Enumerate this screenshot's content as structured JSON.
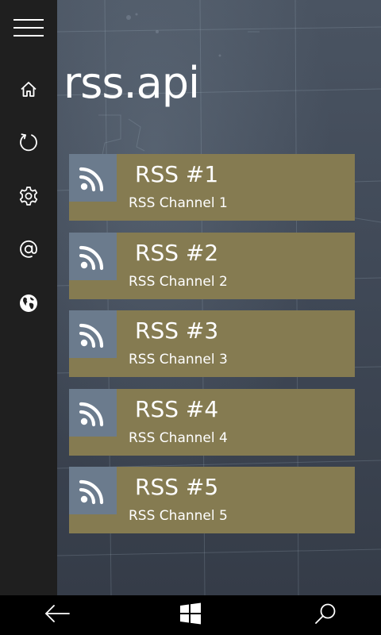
{
  "app": {
    "title": "rss.api"
  },
  "sidebar": {
    "menu_icon": "hamburger-menu-icon",
    "items": [
      {
        "name": "home",
        "icon": "home-icon"
      },
      {
        "name": "refresh",
        "icon": "refresh-icon"
      },
      {
        "name": "settings",
        "icon": "gear-icon"
      },
      {
        "name": "contact",
        "icon": "at-sign-icon"
      },
      {
        "name": "web",
        "icon": "globe-icon"
      }
    ]
  },
  "feeds": [
    {
      "title": "RSS #1",
      "subtitle": "RSS Channel 1",
      "icon": "rss-icon"
    },
    {
      "title": "RSS #2",
      "subtitle": "RSS Channel 2",
      "icon": "rss-icon"
    },
    {
      "title": "RSS #3",
      "subtitle": "RSS Channel 3",
      "icon": "rss-icon"
    },
    {
      "title": "RSS #4",
      "subtitle": "RSS Channel 4",
      "icon": "rss-icon"
    },
    {
      "title": "RSS #5",
      "subtitle": "RSS Channel 5",
      "icon": "rss-icon"
    }
  ],
  "system_bar": {
    "back_icon": "back-arrow-icon",
    "start_icon": "windows-start-icon",
    "search_icon": "search-icon"
  },
  "colors": {
    "sidebar_bg": "#1f1f1f",
    "tile_bg": "#857b51",
    "tile_icon_bg": "#6b7b8d",
    "system_bar_bg": "#000000"
  }
}
